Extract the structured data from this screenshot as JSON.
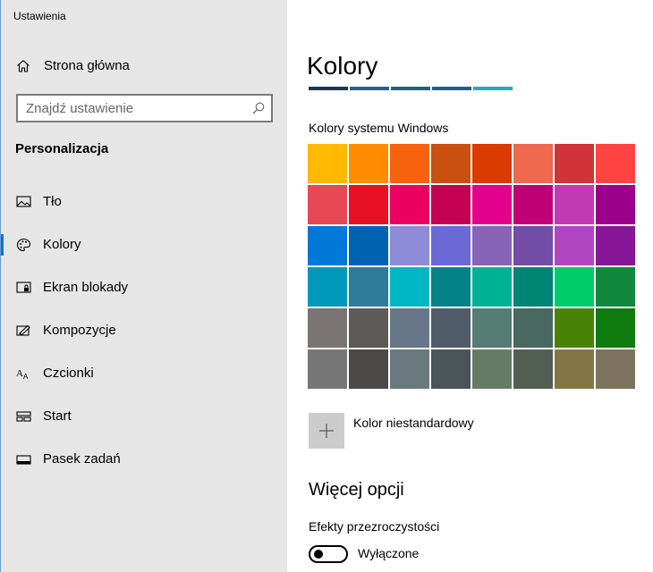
{
  "window": {
    "title": "Ustawienia"
  },
  "sidebar": {
    "home_label": "Strona główna",
    "search_placeholder": "Znajdź ustawienie",
    "section_title": "Personalizacja",
    "items": [
      {
        "label": "Tło",
        "icon": "picture-icon"
      },
      {
        "label": "Kolory",
        "icon": "palette-icon",
        "selected": true
      },
      {
        "label": "Ekran blokady",
        "icon": "lock-screen-icon"
      },
      {
        "label": "Kompozycje",
        "icon": "themes-icon"
      },
      {
        "label": "Czcionki",
        "icon": "fonts-icon"
      },
      {
        "label": "Start",
        "icon": "start-icon"
      },
      {
        "label": "Pasek zadań",
        "icon": "taskbar-icon"
      }
    ]
  },
  "main": {
    "title": "Kolory",
    "accent_strip": [
      "#1f3550",
      "#2d5b8f",
      "#1e6674",
      "#1d5f8a",
      "#2ea7b8"
    ],
    "system_colors_label": "Kolory systemu Windows",
    "palette": [
      [
        "#ffb900",
        "#ff8c00",
        "#f7630c",
        "#ca5010",
        "#da3b01",
        "#ef6950",
        "#d13438",
        "#ff4343"
      ],
      [
        "#e74856",
        "#e81123",
        "#ea005e",
        "#c30052",
        "#e3008c",
        "#bf0077",
        "#c239b3",
        "#9a0089"
      ],
      [
        "#0078d7",
        "#0063b1",
        "#8e8cd8",
        "#6b69d6",
        "#8764b8",
        "#744da9",
        "#b146c2",
        "#881798"
      ],
      [
        "#0099bc",
        "#2d7d9a",
        "#00b7c3",
        "#038387",
        "#00b294",
        "#018574",
        "#00cc6a",
        "#10893e"
      ],
      [
        "#7a7574",
        "#5d5a58",
        "#68768a",
        "#515c6b",
        "#567c73",
        "#486860",
        "#498205",
        "#107c10"
      ],
      [
        "#767676",
        "#4c4a48",
        "#69797e",
        "#4a5459",
        "#647c64",
        "#525e54",
        "#847545",
        "#7e735f"
      ]
    ],
    "custom_color_label": "Kolor niestandardowy",
    "more_options_title": "Więcej opcji",
    "transparency_label": "Efekty przezroczystości",
    "transparency_state": "Wyłączone"
  }
}
